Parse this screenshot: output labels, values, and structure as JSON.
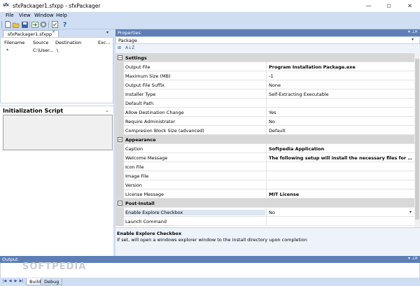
{
  "window": {
    "title": "sfxPackager1.sfxpp - sfxPackager",
    "app_icon_text": "sfx",
    "minimize": "—",
    "maximize": "☐",
    "close": "✕"
  },
  "menu": [
    "File",
    "View",
    "Window",
    "Help"
  ],
  "toolbar": {
    "icons": [
      "new-file-icon",
      "open-folder-icon",
      "save-icon",
      "import-icon",
      "build-icon",
      "checklist-icon",
      "help-icon"
    ]
  },
  "document_tab": {
    "label": "sfxPackager1.sfxpp",
    "close": "×",
    "dropdown": "▾"
  },
  "files": {
    "columns": [
      "Filename",
      "Source",
      "Destination",
      "Exc..."
    ],
    "rows": [
      {
        "filename": "*",
        "source": "C:\\User...",
        "destination": "\\",
        "exclude": ""
      }
    ]
  },
  "init_script": {
    "title": "Initialization Script",
    "chevron": "⌄"
  },
  "properties": {
    "title": "Properties",
    "pin": "▾ ⊥",
    "close": "✕",
    "object": "Package",
    "object_arrow": "▾",
    "sort_labels": [
      "⊞",
      "A↓Z"
    ],
    "categories": [
      {
        "name": "Settings",
        "toggle": "−",
        "items": [
          {
            "name": "Output File",
            "value": "Program Installation Package.exe",
            "bold": true
          },
          {
            "name": "Maximum Size (MB)",
            "value": "-1",
            "bold": false
          },
          {
            "name": "Output File Suffix",
            "value": "None",
            "bold": false
          },
          {
            "name": "Installer Type",
            "value": "Self-Extracting Executable",
            "bold": false
          },
          {
            "name": "Default Path",
            "value": "",
            "bold": false
          },
          {
            "name": "Allow Destination Change",
            "value": "Yes",
            "bold": false
          },
          {
            "name": "Require Administrator",
            "value": "No",
            "bold": false
          },
          {
            "name": "Compresion Block Size (advanced)",
            "value": "Default",
            "bold": false
          }
        ]
      },
      {
        "name": "Appearance",
        "toggle": "−",
        "items": [
          {
            "name": "Caption",
            "value": "Softpedia Application",
            "bold": true
          },
          {
            "name": "Welcome Message",
            "value": "The following setup will install the necessary files for accessing the ...",
            "bold": true
          },
          {
            "name": "Icon File",
            "value": "",
            "bold": false
          },
          {
            "name": "Image File",
            "value": "",
            "bold": false
          },
          {
            "name": "Version",
            "value": "",
            "bold": false
          },
          {
            "name": "License Message",
            "value": "MIT License",
            "bold": true
          }
        ]
      },
      {
        "name": "Post-Install",
        "toggle": "−",
        "items": [
          {
            "name": "Enable Explore Checkbox",
            "value": "No",
            "bold": false,
            "selected": true
          },
          {
            "name": "Launch Command",
            "value": "",
            "bold": false
          }
        ]
      }
    ],
    "description": {
      "title": "Enable Explore Checkbox",
      "text": "If set, will open a windows explorer window to the install directory upon completion"
    }
  },
  "output": {
    "title": "Output",
    "watermark": "SOFTPEDIA",
    "tabs": [
      "Build",
      "Debug"
    ],
    "active_tab": "Build"
  }
}
